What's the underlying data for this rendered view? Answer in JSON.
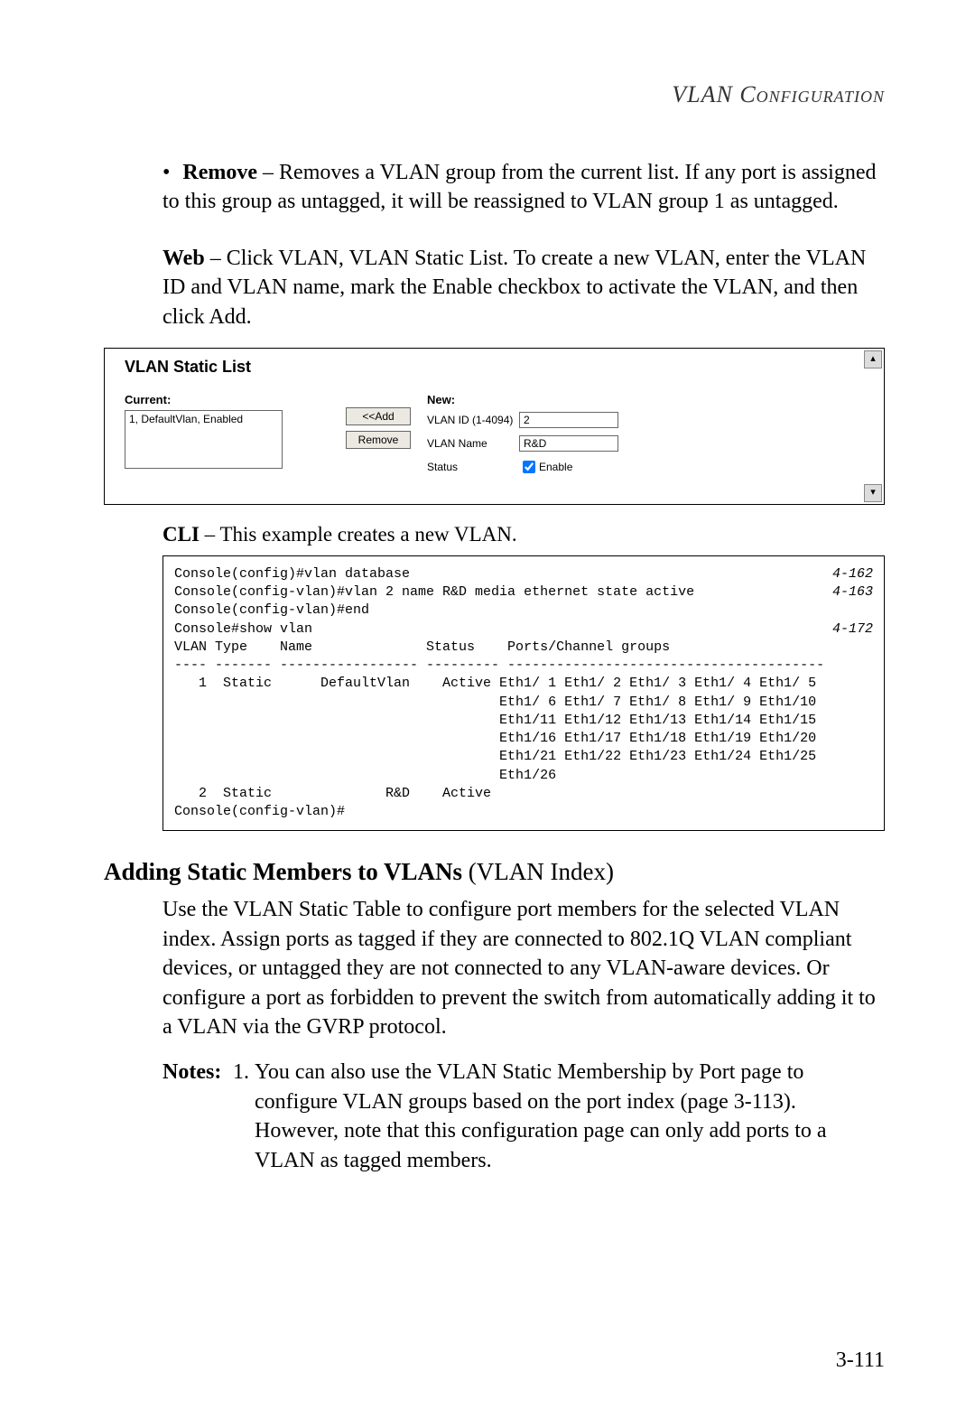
{
  "header": {
    "section_title": "VLAN Configuration"
  },
  "body": {
    "bullet_label": "Remove",
    "bullet_text": " – Removes a VLAN group from the current list. If any port is assigned to this group as untagged, it will be reassigned to VLAN group 1 as untagged.",
    "web_label": "Web",
    "web_text": " – Click VLAN, VLAN Static List. To create a new VLAN, enter the VLAN ID and VLAN name, mark the Enable checkbox to activate the VLAN, and then click Add.",
    "cli_label": "CLI",
    "cli_text": " – This example creates a new VLAN."
  },
  "screenshot": {
    "title": "VLAN Static List",
    "current_label": "Current:",
    "current_item": "1, DefaultVlan, Enabled",
    "add_button": "<<Add",
    "remove_button": "Remove",
    "new_label": "New:",
    "vlanid_label": "VLAN ID (1-4094)",
    "vlanid_value": "2",
    "vlanname_label": "VLAN Name",
    "vlanname_value": "R&D",
    "status_label": "Status",
    "enable_label": "Enable",
    "scroll_up": "▴",
    "scroll_down": "▾"
  },
  "cli": {
    "l1": "Console(config)#vlan database",
    "r1": "4-162",
    "l2": "Console(config-vlan)#vlan 2 name R&D media ethernet state active",
    "r2": "4-163",
    "l3": "Console(config-vlan)#end",
    "l4": "Console#show vlan",
    "r4": "4-172",
    "l5": "VLAN Type    Name              Status    Ports/Channel groups",
    "l6": "---- ------- ----------------- --------- ---------------------------------------",
    "l7": "   1  Static      DefaultVlan    Active Eth1/ 1 Eth1/ 2 Eth1/ 3 Eth1/ 4 Eth1/ 5",
    "l8": "                                        Eth1/ 6 Eth1/ 7 Eth1/ 8 Eth1/ 9 Eth1/10",
    "l9": "                                        Eth1/11 Eth1/12 Eth1/13 Eth1/14 Eth1/15",
    "l10": "                                        Eth1/16 Eth1/17 Eth1/18 Eth1/19 Eth1/20",
    "l11": "                                        Eth1/21 Eth1/22 Eth1/23 Eth1/24 Eth1/25",
    "l12": "                                        Eth1/26",
    "l13": "   2  Static              R&D    Active",
    "l14": "Console(config-vlan)#"
  },
  "section2": {
    "heading_bold": "Adding Static Members to VLANs",
    "heading_rest": " (VLAN Index)",
    "para1": "Use the VLAN Static Table to configure port members for the selected VLAN index. Assign ports as tagged if they are connected to 802.1Q VLAN compliant devices, or untagged they are not connected to any VLAN-aware devices. Or configure a port as forbidden to prevent the switch from automatically adding it to a VLAN via the GVRP protocol.",
    "notes_label": "Notes:",
    "note_num": "1.",
    "note_text": "You can also use the VLAN Static Membership by Port page to configure VLAN groups based on the port index (page 3-113). However, note that this configuration page can only add ports to a VLAN as tagged members."
  },
  "page_number": "3-111"
}
